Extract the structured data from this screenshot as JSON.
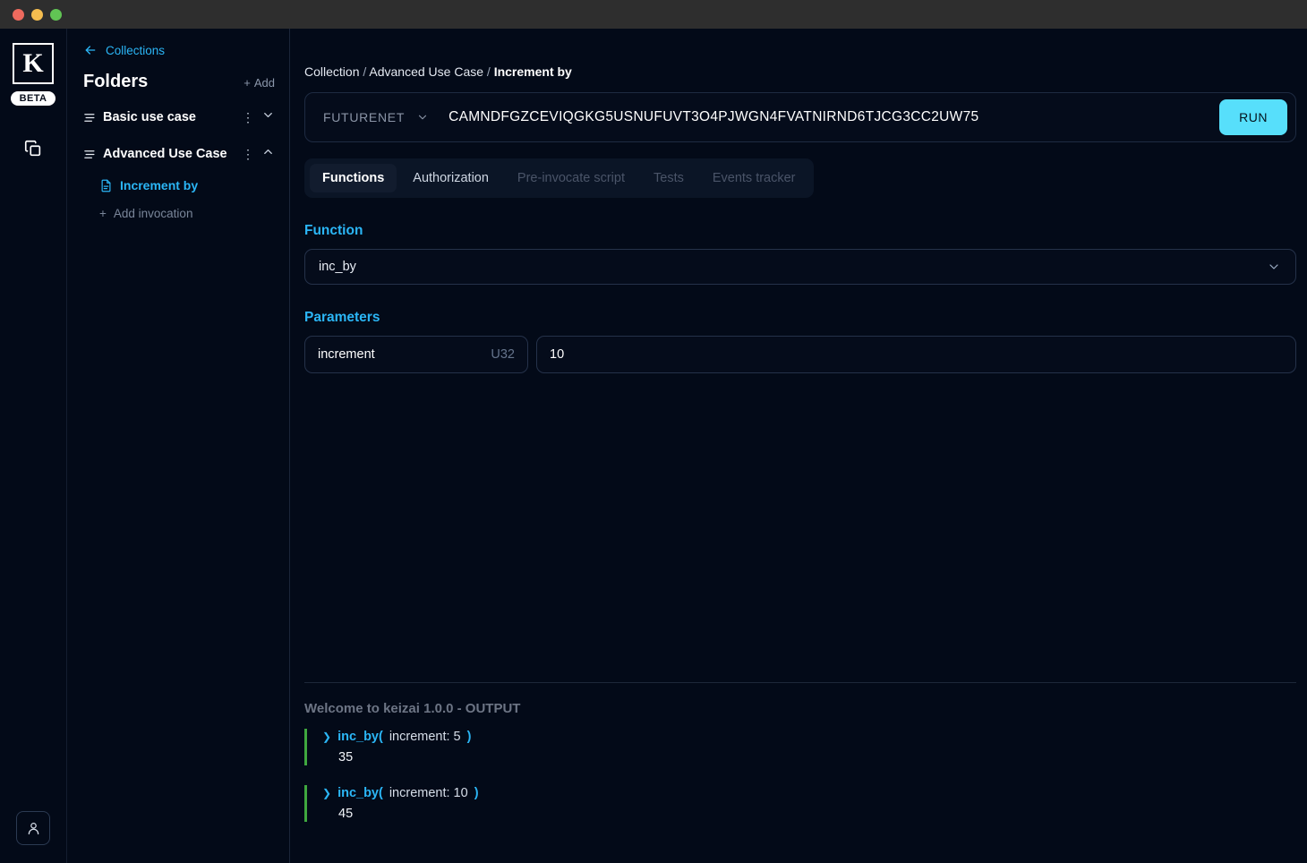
{
  "window": {
    "traffic_lights": [
      "close",
      "minimize",
      "maximize"
    ]
  },
  "rail": {
    "logo_letter": "K",
    "beta_label": "BETA",
    "collections_icon": "copy-stack-icon",
    "account_icon": "user-icon"
  },
  "sidebar": {
    "back_link": "Collections",
    "title": "Folders",
    "add_label": "Add",
    "folders": [
      {
        "name": "Basic use case",
        "expanded": false,
        "invocations": []
      },
      {
        "name": "Advanced Use Case",
        "expanded": true,
        "invocations": [
          "Increment by"
        ]
      }
    ],
    "add_invocation_label": "Add invocation"
  },
  "main": {
    "breadcrumb": {
      "root": "Collection",
      "folder": "Advanced Use Case",
      "current": "Increment by",
      "separator": "/"
    },
    "address_bar": {
      "network": "FUTURENET",
      "contract_id": "CAMNDFGZCEVIQGKG5USNUFUVT3O4PJWGN4FVATNIRND6TJCG3CC2UW75",
      "run_label": "RUN"
    },
    "tabs": [
      {
        "label": "Functions",
        "state": "active"
      },
      {
        "label": "Authorization",
        "state": "enabled"
      },
      {
        "label": "Pre-invocate script",
        "state": "disabled"
      },
      {
        "label": "Tests",
        "state": "disabled"
      },
      {
        "label": "Events tracker",
        "state": "disabled"
      }
    ],
    "function_section": {
      "label": "Function",
      "selected": "inc_by"
    },
    "parameters_section": {
      "label": "Parameters",
      "rows": [
        {
          "name": "increment",
          "type": "U32",
          "value": "10"
        }
      ]
    },
    "output": {
      "title": "Welcome to keizai 1.0.0 - OUTPUT",
      "entries": [
        {
          "fn": "inc_by(",
          "arg": "increment: 5",
          "close": ")",
          "result": "35"
        },
        {
          "fn": "inc_by(",
          "arg": "increment: 10",
          "close": ")",
          "result": "45"
        }
      ]
    }
  },
  "colors": {
    "accent_cyan": "#2bb6f6",
    "run_button": "#57dffb",
    "output_bar_green": "#3fa83f",
    "background": "#030a18",
    "titlebar": "#2e2e2e"
  }
}
